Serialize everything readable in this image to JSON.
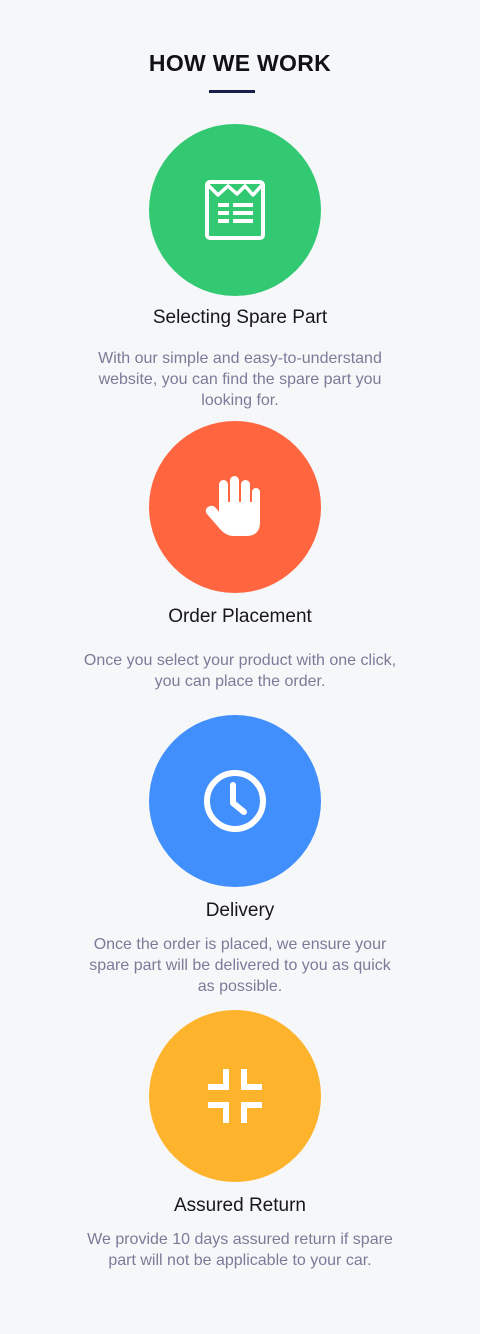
{
  "header": {
    "title": "HOW WE WORK"
  },
  "steps": [
    {
      "title": "Selecting Spare Part",
      "description": "With our simple and easy-to-understand website, you can find the spare part you looking for.",
      "icon": "catalog-icon",
      "color": "#33c973"
    },
    {
      "title": "Order Placement",
      "description": "Once you select your product with one click, you can place the order.",
      "icon": "hand-icon",
      "color": "#ff6640"
    },
    {
      "title": "Delivery",
      "description": "Once the order is placed, we ensure your spare part will be delivered to you as quick as possible.",
      "icon": "clock-icon",
      "color": "#418ffd"
    },
    {
      "title": "Assured Return",
      "description": "We provide 10 days assured return if spare part will not be applicable to your car.",
      "icon": "shrink-arrows-icon",
      "color": "#feb32c"
    }
  ]
}
